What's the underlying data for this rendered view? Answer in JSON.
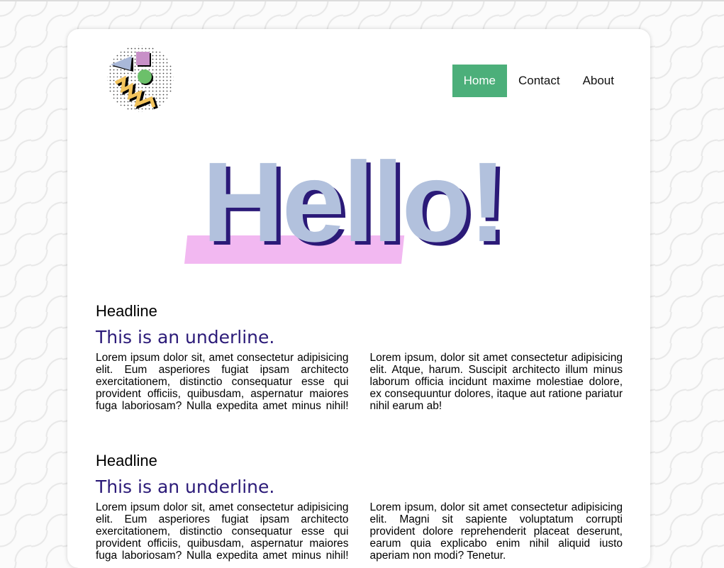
{
  "logo": {
    "icon": "geometric-memphis-logo-icon",
    "colors": {
      "triangle": "#a9b8d8",
      "square": "#c890c8",
      "circle": "#6cc06a",
      "zigzag": "#f2c35c"
    }
  },
  "nav": {
    "items": [
      {
        "label": "Home",
        "active": true
      },
      {
        "label": "Contact",
        "active": false
      },
      {
        "label": "About",
        "active": false
      }
    ]
  },
  "hero": {
    "text": "Hello!",
    "colors": {
      "fill": "#b2c1dd",
      "shadow": "#2b1a78",
      "stripe": "#f2b8f1"
    }
  },
  "sections": [
    {
      "headline": "Headline",
      "subline": "This is an underline.",
      "body": "Lorem ipsum dolor sit, amet consectetur adipisicing elit. Eum asperiores fugiat ipsam architecto exercitationem, distinctio consequatur esse qui provident officiis, quibusdam, aspernatur maiores fuga laboriosam? Nulla expedita amet minus nihil! Lorem ipsum, dolor sit amet consectetur adipisicing elit. Atque, harum. Suscipit architecto illum minus laborum officia incidunt maxime molestiae dolore, ex consequuntur dolores, itaque aut ratione pariatur nihil earum ab!"
    },
    {
      "headline": "Headline",
      "subline": "This is an underline.",
      "body": "Lorem ipsum dolor sit, amet consectetur adipisicing elit. Eum asperiores fugiat ipsam architecto exercitationem, distinctio consequatur esse qui provident officiis, quibusdam, aspernatur maiores fuga laboriosam? Nulla expedita amet minus nihil! Lorem ipsum, dolor sit amet consectetur adipisicing elit. Magni sit sapiente voluptatum corrupti provident dolore reprehenderit placeat deserunt, earum quia explicabo enim nihil aliquid iusto aperiam non modi? Tenetur."
    }
  ],
  "theme": {
    "accent": "#4caf7a",
    "underline_color": "#2b1a78"
  }
}
